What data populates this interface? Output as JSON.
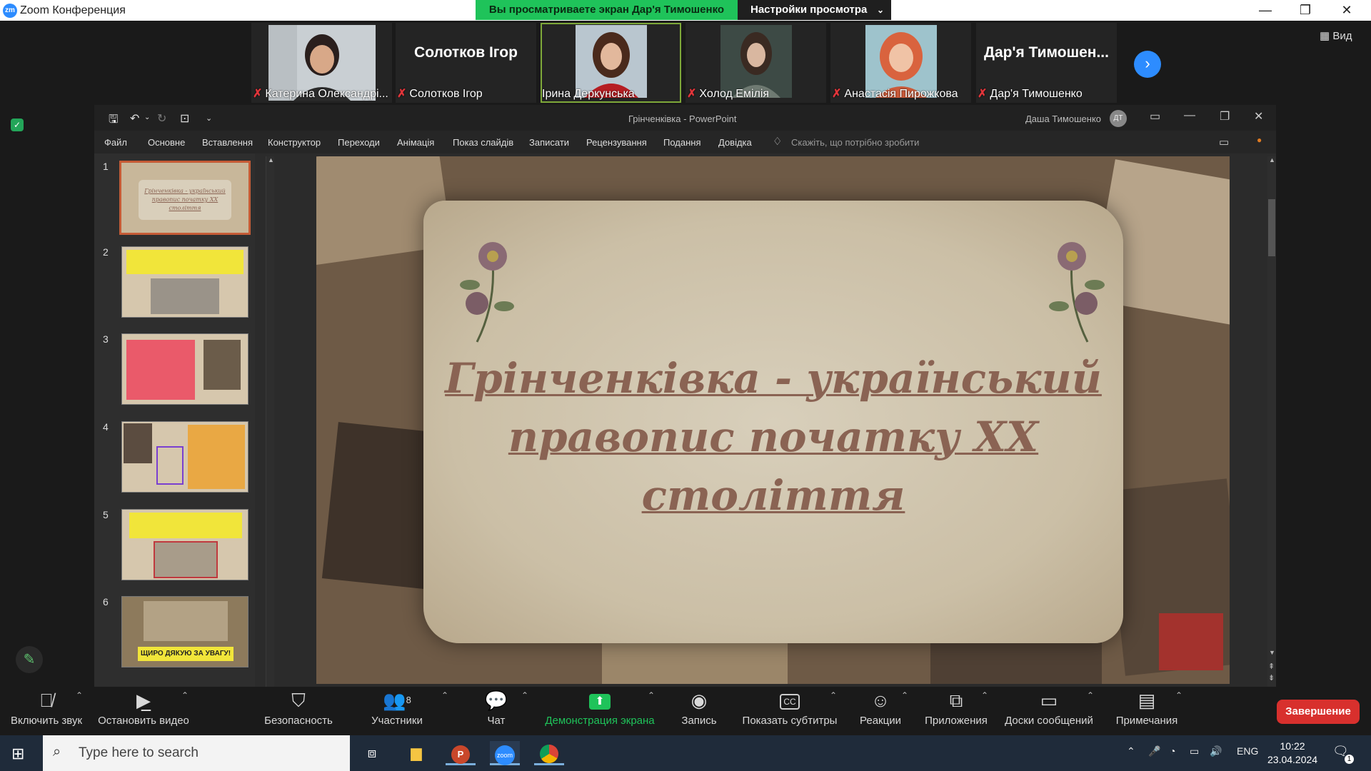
{
  "zoom_window": {
    "title": "Zoom Конференция",
    "banner_text": "Вы просматриваете экран Дар'я Тимошенко",
    "view_settings_label": "Настройки просмотра",
    "view_label": "Вид"
  },
  "participants": [
    {
      "name": "Катерина Олександрі...",
      "muted": true,
      "video": true
    },
    {
      "name": "Солотков Ігор",
      "display_name": "Солотков Ігор",
      "muted": true,
      "video": false
    },
    {
      "name": "Ірина Деркунська",
      "muted": false,
      "video": true,
      "active_speaker": true
    },
    {
      "name": "Холод Емілія",
      "muted": true,
      "video": true
    },
    {
      "name": "Анастасія Пирожкова",
      "muted": true,
      "video": true
    },
    {
      "name": "Дар'я Тимошенко",
      "display_name": "Дар'я Тимошен...",
      "muted": true,
      "video": false
    }
  ],
  "powerpoint": {
    "doc_title": "Грінченківка  -  PowerPoint",
    "user_name": "Даша Тимошенко",
    "user_initials": "ДТ",
    "ribbon_tabs": [
      "Файл",
      "Основне",
      "Вставлення",
      "Конструктор",
      "Переходи",
      "Анімація",
      "Показ слайдів",
      "Записати",
      "Рецензування",
      "Подання",
      "Довідка"
    ],
    "tell_me_placeholder": "Скажіть, що потрібно зробити",
    "thumbnails": [
      {
        "num": "1",
        "caption": "Грінченківка - український правопис початку XX століття",
        "selected": true
      },
      {
        "num": "2"
      },
      {
        "num": "3"
      },
      {
        "num": "4"
      },
      {
        "num": "5"
      },
      {
        "num": "6",
        "caption": "ЩИРО ДЯКУЮ ЗА УВАГУ!"
      }
    ],
    "slide_title": "Грінченківка - український правопис початку XX століття"
  },
  "controls": {
    "mute": "Включить звук",
    "video": "Остановить видео",
    "security": "Безопасность",
    "participants": "Участники",
    "participants_count": "8",
    "chat": "Чат",
    "share": "Демонстрация экрана",
    "record": "Запись",
    "captions": "Показать субтитры",
    "reactions": "Реакции",
    "apps": "Приложения",
    "whiteboards": "Доски сообщений",
    "notes": "Примечания",
    "end": "Завершение"
  },
  "taskbar": {
    "search_placeholder": "Type here to search",
    "language": "ENG",
    "time": "10:22",
    "date": "23.04.2024",
    "notification_count": "1"
  },
  "colors": {
    "zoom_green": "#1fc35a",
    "zoom_blue": "#2d8cff",
    "end_red": "#d8302d",
    "slide_title": "#8a6353"
  }
}
